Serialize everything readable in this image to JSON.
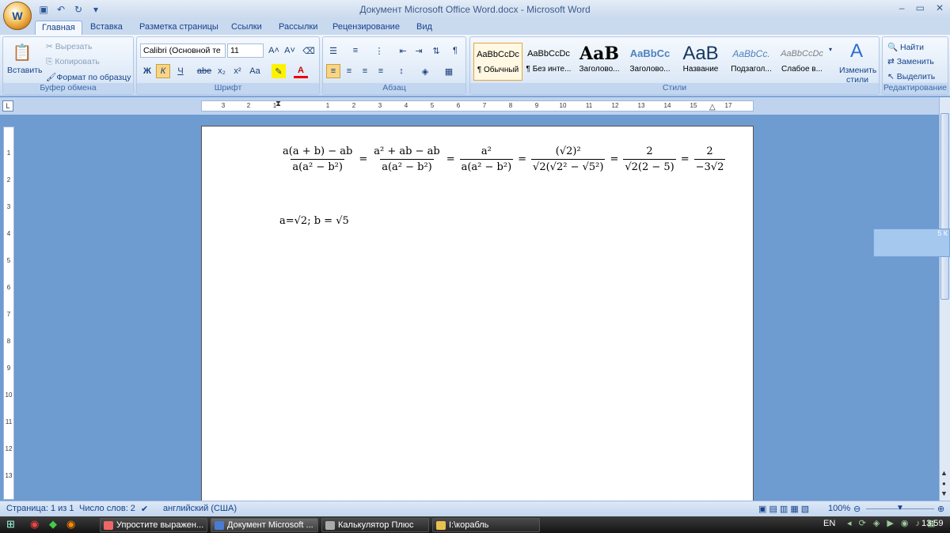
{
  "window": {
    "title": "Документ Microsoft Office Word.docx - Microsoft Word",
    "controls": [
      "–",
      "▭",
      "✕"
    ]
  },
  "office_button": {
    "label": "W"
  },
  "tabs": [
    {
      "label": "Главная"
    },
    {
      "label": "Вставка"
    },
    {
      "label": "Разметка страницы"
    },
    {
      "label": "Ссылки"
    },
    {
      "label": "Рассылки"
    },
    {
      "label": "Рецензирование"
    },
    {
      "label": "Вид"
    }
  ],
  "clipboard": {
    "paste": "Вставить",
    "cut": "Вырезать",
    "copy": "Копировать",
    "format_painter": "Формат по образцу",
    "group": "Буфер обмена"
  },
  "font": {
    "name": "Calibri (Основной те",
    "size": "11",
    "group": "Шрифт",
    "bold": "Ж",
    "italic": "К",
    "underline": "Ч",
    "strike": "abe",
    "sub": "x₂",
    "sup": "x²",
    "case": "Aa",
    "grow": "A˄",
    "shrink": "A˅"
  },
  "paragraph": {
    "group": "Абзац",
    "pilcrow": "¶"
  },
  "styles": {
    "group": "Стили",
    "items": [
      {
        "preview": "AaBbCcDc",
        "name": "¶ Обычный"
      },
      {
        "preview": "AaBbCcDc",
        "name": "¶ Без инте..."
      },
      {
        "preview": "AaB",
        "name": "Заголово..."
      },
      {
        "preview": "AaBbCc",
        "name": "Заголово..."
      },
      {
        "preview": "AaB",
        "name": "Название"
      },
      {
        "preview": "AaBbCc.",
        "name": "Подзагол..."
      },
      {
        "preview": "AaBbCcDc",
        "name": "Слабое в..."
      }
    ],
    "change_label": "Изменить стили"
  },
  "editing": {
    "group": "Редактирование",
    "find": "Найти",
    "replace": "Заменить",
    "select": "Выделить"
  },
  "ruler": {
    "ticks": [
      "3",
      "2",
      "1",
      "1",
      "2",
      "3",
      "4",
      "5",
      "6",
      "7",
      "8",
      "9",
      "10",
      "11",
      "12",
      "13",
      "14",
      "15",
      "16",
      "17"
    ],
    "vticks": [
      "1",
      "2",
      "3",
      "4",
      "5",
      "6",
      "7",
      "8",
      "9",
      "10",
      "11",
      "12",
      "13"
    ]
  },
  "document": {
    "eq": {
      "f1n": "a(a + b) − ab",
      "f1d": "a(a² − b²)",
      "f2n": "a² + ab − ab",
      "f2d": "a(a² − b²)",
      "f3n": "a²",
      "f3d": "a(a² − b²)",
      "f4n": "(√2)²",
      "f4d": "√2(√2² − √5²)",
      "f5n": "2",
      "f5d": "√2(2 − 5)",
      "f6n": "2",
      "f6d": "−3√2",
      "eq": "="
    },
    "given": "a=√2; b = √5"
  },
  "float_panel": {
    "text": "5 К"
  },
  "status": {
    "page": "Страница: 1 из 1",
    "words": "Число слов: 2",
    "lang": "английский (США)",
    "zoom": "100%"
  },
  "taskbar": {
    "items": [
      {
        "label": "Упростите выражен..."
      },
      {
        "label": "Документ Microsoft ..."
      },
      {
        "label": "Калькулятор Плюс"
      },
      {
        "label": "I:\\корабль"
      }
    ],
    "lang": "EN",
    "clock": "13:59"
  }
}
